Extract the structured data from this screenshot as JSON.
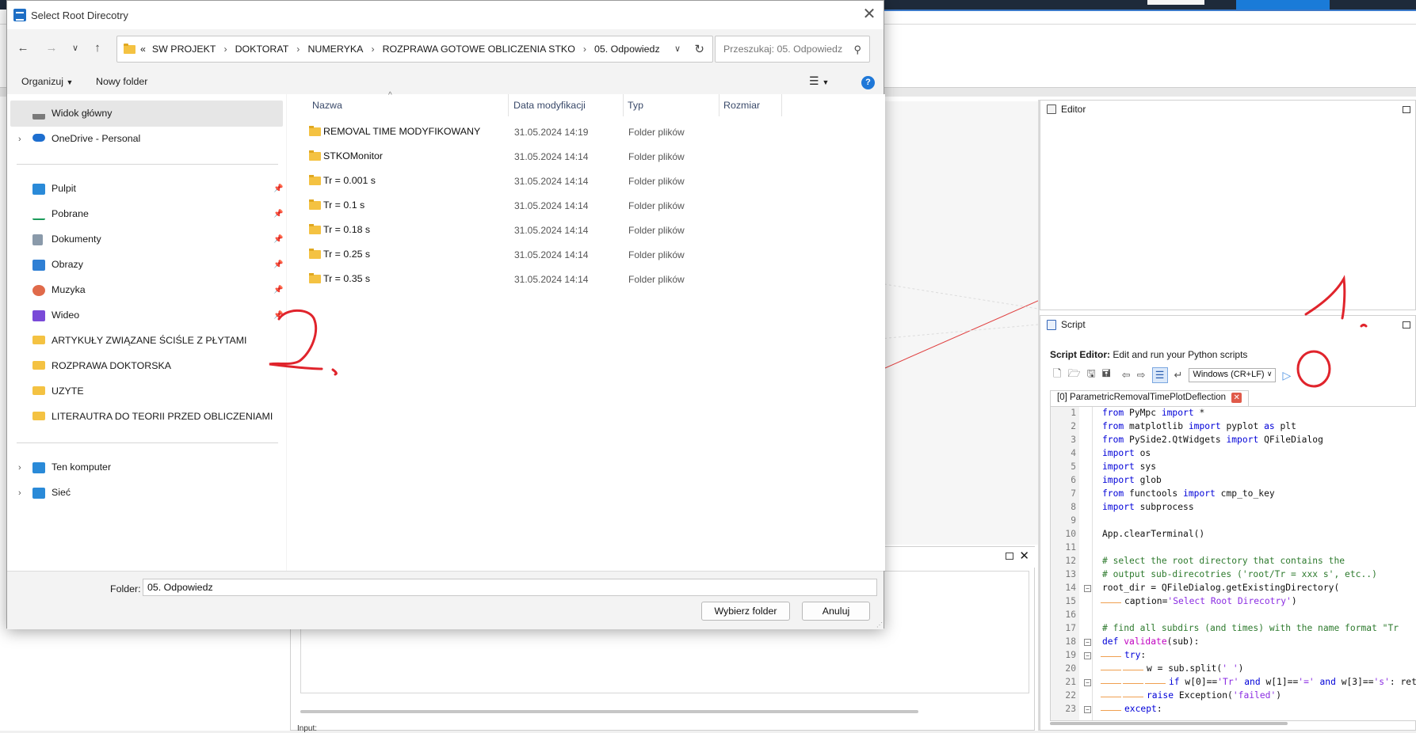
{
  "dialog": {
    "title": "Select Root Direcotry",
    "breadcrumb": [
      "«",
      "SW PROJEKT",
      "DOKTORAT",
      "NUMERYKA",
      "ROZPRAWA GOTOWE OBLICZENIA STKO",
      "05. Odpowiedz"
    ],
    "search_placeholder": "Przeszukaj: 05. Odpowiedz",
    "toolbar": {
      "organize": "Organizuj",
      "new_folder": "Nowy folder"
    },
    "nav": {
      "top": [
        {
          "label": "Widok główny",
          "icon": "home-icon"
        },
        {
          "label": "OneDrive - Personal",
          "icon": "cloud-icon"
        }
      ],
      "quick": [
        {
          "label": "Pulpit",
          "icon": "desktop-icon"
        },
        {
          "label": "Pobrane",
          "icon": "download-icon"
        },
        {
          "label": "Dokumenty",
          "icon": "document-icon"
        },
        {
          "label": "Obrazy",
          "icon": "image-icon"
        },
        {
          "label": "Muzyka",
          "icon": "music-icon"
        },
        {
          "label": "Wideo",
          "icon": "video-icon"
        },
        {
          "label": "ARTYKUŁY ZWIĄZANE ŚCIŚLE Z PŁYTAMI",
          "icon": "folder-icon"
        },
        {
          "label": "ROZPRAWA DOKTORSKA",
          "icon": "folder-icon"
        },
        {
          "label": "UZYTE",
          "icon": "folder-icon"
        },
        {
          "label": "LITERAUTRA DO TEORII PRZED OBLICZENIAMI",
          "icon": "folder-icon"
        }
      ],
      "bottom": [
        {
          "label": "Ten komputer",
          "icon": "computer-icon"
        },
        {
          "label": "Sieć",
          "icon": "network-icon"
        }
      ]
    },
    "columns": {
      "name": "Nazwa",
      "date": "Data modyfikacji",
      "type": "Typ",
      "size": "Rozmiar"
    },
    "rows": [
      {
        "name": "REMOVAL TIME MODYFIKOWANY",
        "date": "31.05.2024 14:19",
        "type": "Folder plików"
      },
      {
        "name": "STKOMonitor",
        "date": "31.05.2024 14:14",
        "type": "Folder plików"
      },
      {
        "name": "Tr = 0.001 s",
        "date": "31.05.2024 14:14",
        "type": "Folder plików"
      },
      {
        "name": "Tr = 0.1 s",
        "date": "31.05.2024 14:14",
        "type": "Folder plików"
      },
      {
        "name": "Tr = 0.18 s",
        "date": "31.05.2024 14:14",
        "type": "Folder plików"
      },
      {
        "name": "Tr = 0.25 s",
        "date": "31.05.2024 14:14",
        "type": "Folder plików"
      },
      {
        "name": "Tr = 0.35 s",
        "date": "31.05.2024 14:14",
        "type": "Folder plików"
      }
    ],
    "folder_label": "Folder:",
    "folder_value": "05. Odpowiedz",
    "select_button": "Wybierz folder",
    "cancel_button": "Anuluj"
  },
  "background": {
    "editor_title": "Editor",
    "script_title": "Script",
    "script_heading_bold": "Script Editor:",
    "script_heading_rest": " Edit and run your Python scripts",
    "line_ending": "Windows (CR+LF)",
    "tab_name": "[0] ParametricRemovalTimePlotDeflection",
    "code_lines": [
      "from PyMpc import *",
      "from matplotlib import pyplot as plt",
      "from PySide2.QtWidgets import QFileDialog",
      "import os",
      "import sys",
      "import glob",
      "from functools import cmp_to_key",
      "import subprocess",
      "",
      "App.clearTerminal()",
      "",
      "# select the root directory that contains the",
      "# output sub-direcotries ('root/Tr = xxx s', etc..)",
      "root_dir = QFileDialog.getExistingDirectory(",
      "caption='Select Root Direcotry')",
      "",
      "# find all subdirs (and times) with the name format \"Tr",
      "def validate(sub):",
      "try:",
      "w = sub.split(' ')",
      "if w[0]=='Tr' and w[1]=='=' and w[3]=='s': retur",
      "raise Exception('failed')",
      "except:"
    ],
    "input_label": "Input:"
  },
  "annotations": [
    "1.",
    "2."
  ]
}
